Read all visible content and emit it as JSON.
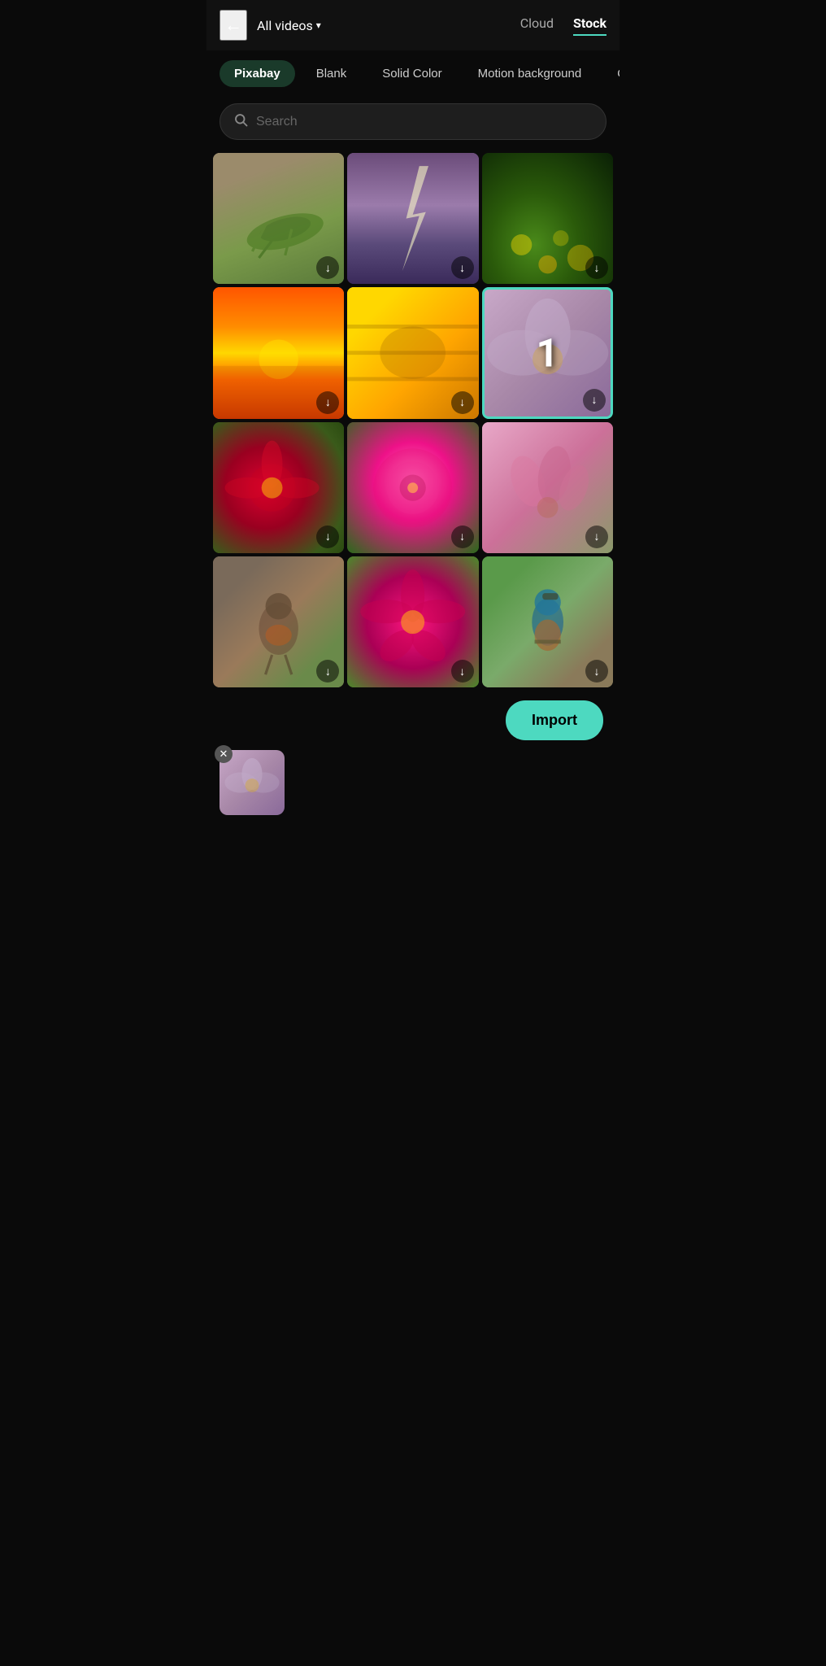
{
  "header": {
    "back_label": "←",
    "dropdown_label": "All videos",
    "dropdown_icon": "chevron-down",
    "tabs": [
      {
        "id": "cloud",
        "label": "Cloud",
        "active": false
      },
      {
        "id": "stock",
        "label": "Stock",
        "active": true
      }
    ]
  },
  "filter_chips": [
    {
      "id": "pixabay",
      "label": "Pixabay",
      "active": true
    },
    {
      "id": "blank",
      "label": "Blank",
      "active": false
    },
    {
      "id": "solid-color",
      "label": "Solid Color",
      "active": false
    },
    {
      "id": "motion-bg",
      "label": "Motion background",
      "active": false
    },
    {
      "id": "open",
      "label": "Ope...",
      "active": false
    }
  ],
  "search": {
    "placeholder": "Search",
    "value": ""
  },
  "grid": {
    "items": [
      {
        "id": 1,
        "type": "video",
        "bg": "cell-grasshopper",
        "selected": false,
        "downloaded": false
      },
      {
        "id": 2,
        "type": "video",
        "bg": "cell-lightning",
        "selected": false,
        "downloaded": false
      },
      {
        "id": 3,
        "type": "video",
        "bg": "cell-bokeh",
        "selected": false,
        "downloaded": false
      },
      {
        "id": 4,
        "type": "video",
        "bg": "cell-sunset",
        "selected": false,
        "downloaded": false
      },
      {
        "id": 5,
        "type": "video",
        "bg": "cell-bee",
        "selected": false,
        "downloaded": false
      },
      {
        "id": 6,
        "type": "video",
        "bg": "cell-flower-selected",
        "selected": true,
        "badge": "1",
        "downloaded": false
      },
      {
        "id": 7,
        "type": "video",
        "bg": "cell-cosmos",
        "selected": false,
        "downloaded": false
      },
      {
        "id": 8,
        "type": "video",
        "bg": "cell-dahlia",
        "selected": false,
        "downloaded": false
      },
      {
        "id": 9,
        "type": "video",
        "bg": "cell-pink-buds",
        "selected": false,
        "downloaded": false
      },
      {
        "id": 10,
        "type": "video",
        "bg": "cell-robin",
        "selected": false,
        "downloaded": false
      },
      {
        "id": 11,
        "type": "video",
        "bg": "cell-pink-cosmos",
        "selected": false,
        "downloaded": false
      },
      {
        "id": 12,
        "type": "video",
        "bg": "cell-kingfisher",
        "selected": false,
        "downloaded": false
      }
    ]
  },
  "import_button": {
    "label": "Import"
  },
  "preview": {
    "visible": true,
    "close_icon": "✕",
    "bg": "cell-flower-selected"
  },
  "icons": {
    "back": "←",
    "dropdown_arrow": "▾",
    "search": "🔍",
    "download": "↓",
    "close": "✕"
  }
}
